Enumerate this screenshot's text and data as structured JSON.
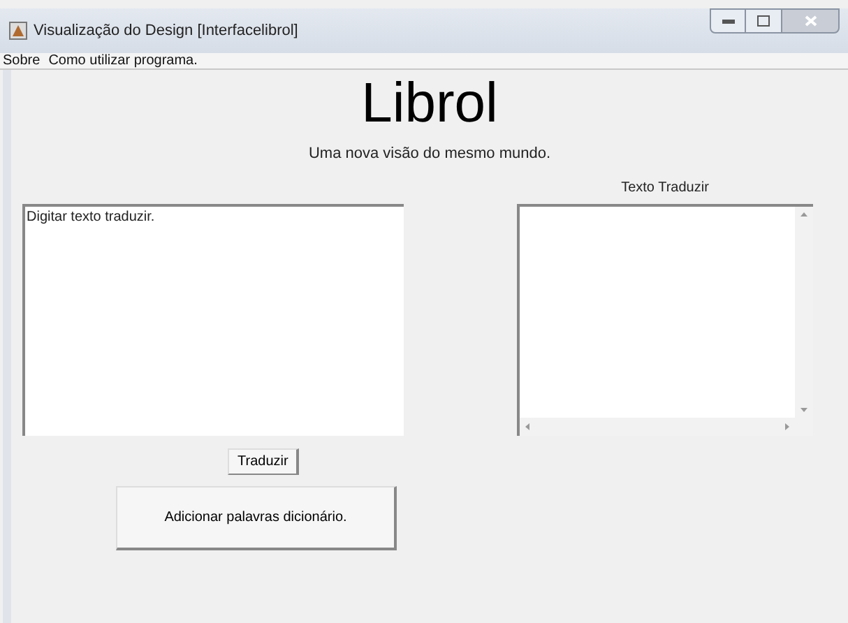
{
  "window": {
    "title": "Visualização do Design [Interfacelibrol]"
  },
  "menu": [
    {
      "label": "Sobre"
    },
    {
      "label": "Como utilizar programa."
    }
  ],
  "heading": "Librol",
  "subtitle": "Uma nova visão do mesmo mundo.",
  "input": {
    "value": "Digitar texto traduzir."
  },
  "output": {
    "label": "Texto Traduzir"
  },
  "buttons": [
    {
      "label": "Traduzir"
    },
    {
      "label": "Adicionar palavras dicionário."
    }
  ]
}
